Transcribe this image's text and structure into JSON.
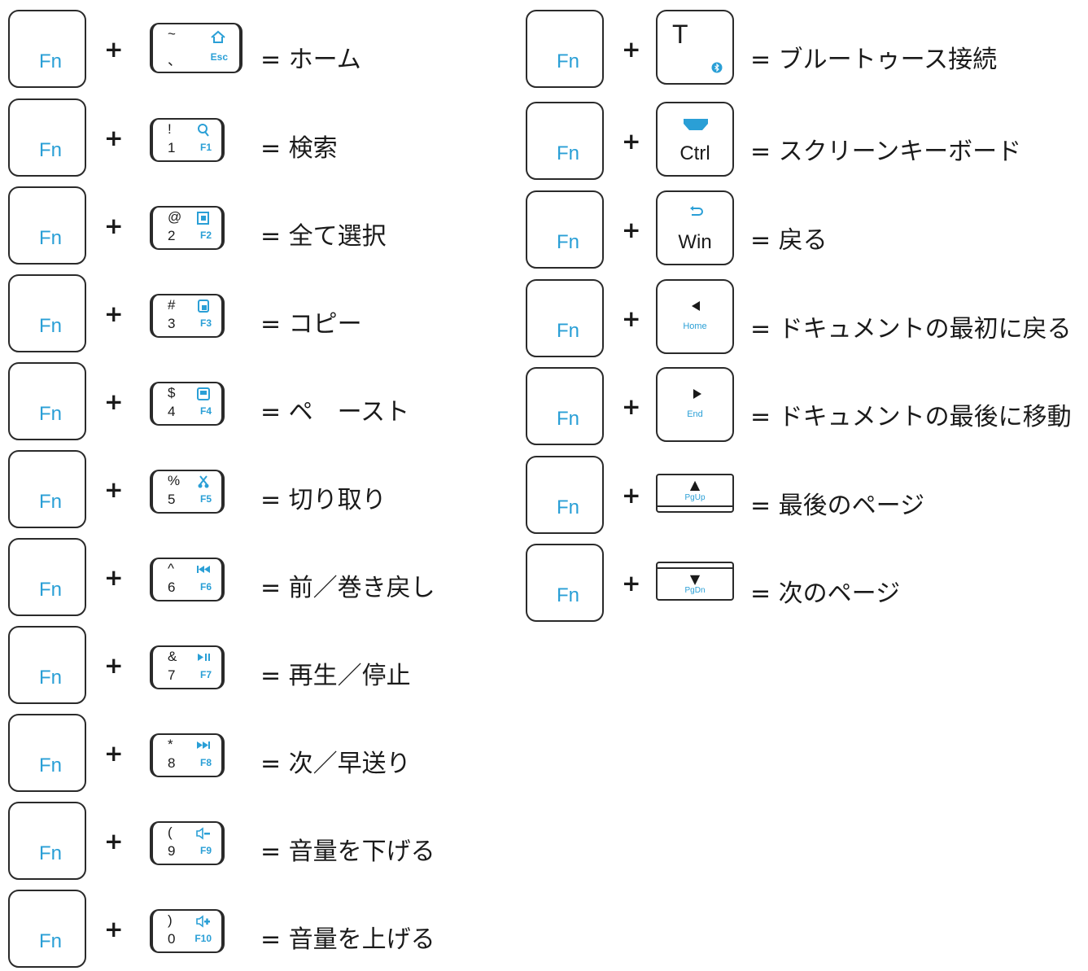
{
  "fn_label": "Fn",
  "plus": "+",
  "left": [
    {
      "sym": "~",
      "digit": "、",
      "fkey": "Esc",
      "icon": "home-icon",
      "desc": "= ホーム"
    },
    {
      "sym": "!",
      "digit": "1",
      "fkey": "F1",
      "icon": "search-icon",
      "desc": "= 検索"
    },
    {
      "sym": "@",
      "digit": "2",
      "fkey": "F2",
      "icon": "select-all-icon",
      "desc": "= 全て選択"
    },
    {
      "sym": "#",
      "digit": "3",
      "fkey": "F3",
      "icon": "copy-icon",
      "desc": "= コピー"
    },
    {
      "sym": "$",
      "digit": "4",
      "fkey": "F4",
      "icon": "paste-icon",
      "desc": "= ペ　ースト"
    },
    {
      "sym": "%",
      "digit": "5",
      "fkey": "F5",
      "icon": "scissors-icon",
      "desc": "= 切り取り"
    },
    {
      "sym": "^",
      "digit": "6",
      "fkey": "F6",
      "icon": "previous-track-icon",
      "desc": "= 前／巻き戻し"
    },
    {
      "sym": "&",
      "digit": "7",
      "fkey": "F7",
      "icon": "play-pause-icon",
      "desc": "= 再生／停止"
    },
    {
      "sym": "*",
      "digit": "8",
      "fkey": "F8",
      "icon": "next-track-icon",
      "desc": "= 次／早送り"
    },
    {
      "sym": "(",
      "digit": "9",
      "fkey": "F9",
      "icon": "volume-down-icon",
      "desc": "= 音量を下げる"
    },
    {
      "sym": ")",
      "digit": "0",
      "fkey": "F10",
      "icon": "volume-up-icon",
      "desc": "= 音量を上げる"
    }
  ],
  "right": [
    {
      "main": "T",
      "sub": "",
      "icon": "bluetooth-icon",
      "desc": "= ブルートゥース接続"
    },
    {
      "main": "Ctrl",
      "sub": "",
      "icon": "keyboard-icon",
      "desc": "= スクリーンキーボード"
    },
    {
      "main": "Win",
      "sub": "",
      "icon": "back-arrow-icon",
      "desc": "= 戻る"
    },
    {
      "main": "",
      "sub": "Home",
      "icon": "left-triangle-icon",
      "desc": "= ドキュメントの最初に戻る"
    },
    {
      "main": "",
      "sub": "End",
      "icon": "right-triangle-icon",
      "desc": "= ドキュメントの最後に移動"
    },
    {
      "main": "",
      "sub": "PgUp",
      "icon": "up-triangle-icon",
      "desc": "= 最後のページ"
    },
    {
      "main": "",
      "sub": "PgDn",
      "icon": "down-triangle-icon",
      "desc": "= 次のページ"
    }
  ],
  "colors": {
    "fn_blue": "#2a9fd6",
    "outline": "#2a2a2a"
  }
}
